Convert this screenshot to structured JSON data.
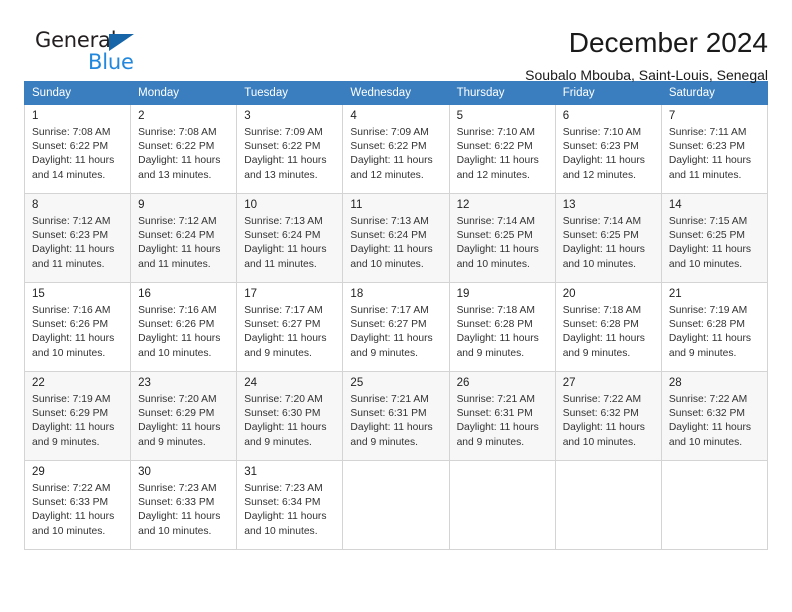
{
  "brand": {
    "name_part1": "General",
    "name_part2": "Blue",
    "triangle_color": "#1565a8",
    "blue_color": "#2288dd"
  },
  "header": {
    "title": "December 2024",
    "subtitle": "Soubalo Mbouba, Saint-Louis, Senegal"
  },
  "theme": {
    "header_bg": "#3a7ebf",
    "header_text": "#ffffff",
    "alt_row_bg": "#f7f7f7",
    "grid_border": "#d4d4d4"
  },
  "weekdays": [
    "Sunday",
    "Monday",
    "Tuesday",
    "Wednesday",
    "Thursday",
    "Friday",
    "Saturday"
  ],
  "weeks": [
    [
      {
        "day": "1",
        "detail": "Sunrise: 7:08 AM\nSunset: 6:22 PM\nDaylight: 11 hours\nand 14 minutes."
      },
      {
        "day": "2",
        "detail": "Sunrise: 7:08 AM\nSunset: 6:22 PM\nDaylight: 11 hours\nand 13 minutes."
      },
      {
        "day": "3",
        "detail": "Sunrise: 7:09 AM\nSunset: 6:22 PM\nDaylight: 11 hours\nand 13 minutes."
      },
      {
        "day": "4",
        "detail": "Sunrise: 7:09 AM\nSunset: 6:22 PM\nDaylight: 11 hours\nand 12 minutes."
      },
      {
        "day": "5",
        "detail": "Sunrise: 7:10 AM\nSunset: 6:22 PM\nDaylight: 11 hours\nand 12 minutes."
      },
      {
        "day": "6",
        "detail": "Sunrise: 7:10 AM\nSunset: 6:23 PM\nDaylight: 11 hours\nand 12 minutes."
      },
      {
        "day": "7",
        "detail": "Sunrise: 7:11 AM\nSunset: 6:23 PM\nDaylight: 11 hours\nand 11 minutes."
      }
    ],
    [
      {
        "day": "8",
        "detail": "Sunrise: 7:12 AM\nSunset: 6:23 PM\nDaylight: 11 hours\nand 11 minutes."
      },
      {
        "day": "9",
        "detail": "Sunrise: 7:12 AM\nSunset: 6:24 PM\nDaylight: 11 hours\nand 11 minutes."
      },
      {
        "day": "10",
        "detail": "Sunrise: 7:13 AM\nSunset: 6:24 PM\nDaylight: 11 hours\nand 11 minutes."
      },
      {
        "day": "11",
        "detail": "Sunrise: 7:13 AM\nSunset: 6:24 PM\nDaylight: 11 hours\nand 10 minutes."
      },
      {
        "day": "12",
        "detail": "Sunrise: 7:14 AM\nSunset: 6:25 PM\nDaylight: 11 hours\nand 10 minutes."
      },
      {
        "day": "13",
        "detail": "Sunrise: 7:14 AM\nSunset: 6:25 PM\nDaylight: 11 hours\nand 10 minutes."
      },
      {
        "day": "14",
        "detail": "Sunrise: 7:15 AM\nSunset: 6:25 PM\nDaylight: 11 hours\nand 10 minutes."
      }
    ],
    [
      {
        "day": "15",
        "detail": "Sunrise: 7:16 AM\nSunset: 6:26 PM\nDaylight: 11 hours\nand 10 minutes."
      },
      {
        "day": "16",
        "detail": "Sunrise: 7:16 AM\nSunset: 6:26 PM\nDaylight: 11 hours\nand 10 minutes."
      },
      {
        "day": "17",
        "detail": "Sunrise: 7:17 AM\nSunset: 6:27 PM\nDaylight: 11 hours\nand 9 minutes."
      },
      {
        "day": "18",
        "detail": "Sunrise: 7:17 AM\nSunset: 6:27 PM\nDaylight: 11 hours\nand 9 minutes."
      },
      {
        "day": "19",
        "detail": "Sunrise: 7:18 AM\nSunset: 6:28 PM\nDaylight: 11 hours\nand 9 minutes."
      },
      {
        "day": "20",
        "detail": "Sunrise: 7:18 AM\nSunset: 6:28 PM\nDaylight: 11 hours\nand 9 minutes."
      },
      {
        "day": "21",
        "detail": "Sunrise: 7:19 AM\nSunset: 6:28 PM\nDaylight: 11 hours\nand 9 minutes."
      }
    ],
    [
      {
        "day": "22",
        "detail": "Sunrise: 7:19 AM\nSunset: 6:29 PM\nDaylight: 11 hours\nand 9 minutes."
      },
      {
        "day": "23",
        "detail": "Sunrise: 7:20 AM\nSunset: 6:29 PM\nDaylight: 11 hours\nand 9 minutes."
      },
      {
        "day": "24",
        "detail": "Sunrise: 7:20 AM\nSunset: 6:30 PM\nDaylight: 11 hours\nand 9 minutes."
      },
      {
        "day": "25",
        "detail": "Sunrise: 7:21 AM\nSunset: 6:31 PM\nDaylight: 11 hours\nand 9 minutes."
      },
      {
        "day": "26",
        "detail": "Sunrise: 7:21 AM\nSunset: 6:31 PM\nDaylight: 11 hours\nand 9 minutes."
      },
      {
        "day": "27",
        "detail": "Sunrise: 7:22 AM\nSunset: 6:32 PM\nDaylight: 11 hours\nand 10 minutes."
      },
      {
        "day": "28",
        "detail": "Sunrise: 7:22 AM\nSunset: 6:32 PM\nDaylight: 11 hours\nand 10 minutes."
      }
    ],
    [
      {
        "day": "29",
        "detail": "Sunrise: 7:22 AM\nSunset: 6:33 PM\nDaylight: 11 hours\nand 10 minutes."
      },
      {
        "day": "30",
        "detail": "Sunrise: 7:23 AM\nSunset: 6:33 PM\nDaylight: 11 hours\nand 10 minutes."
      },
      {
        "day": "31",
        "detail": "Sunrise: 7:23 AM\nSunset: 6:34 PM\nDaylight: 11 hours\nand 10 minutes."
      },
      {
        "day": "",
        "detail": ""
      },
      {
        "day": "",
        "detail": ""
      },
      {
        "day": "",
        "detail": ""
      },
      {
        "day": "",
        "detail": ""
      }
    ]
  ]
}
